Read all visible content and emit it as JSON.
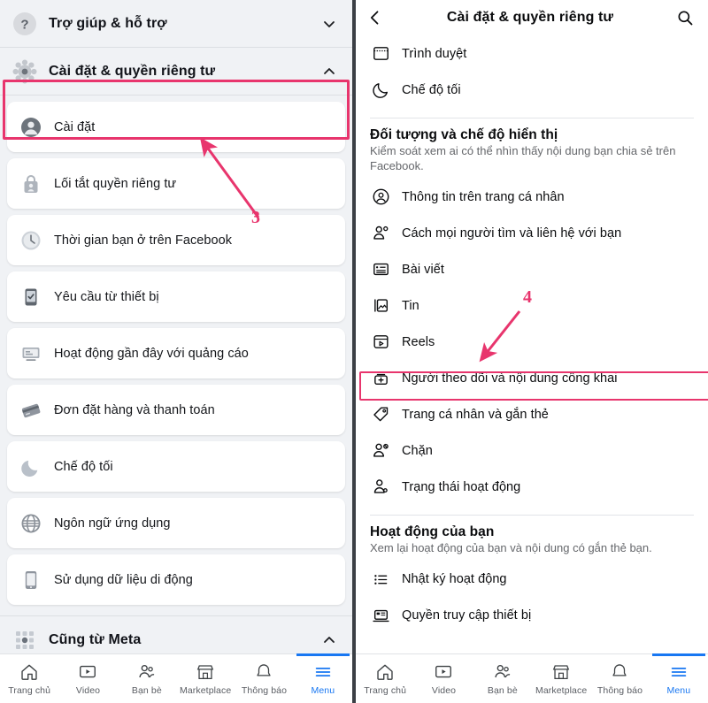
{
  "left_panel": {
    "sections": [
      {
        "id": "help",
        "label": "Trợ giúp & hỗ trợ",
        "icon": "question-circle-icon",
        "chevron": "chevron-down-icon",
        "expanded": false
      },
      {
        "id": "settings_privacy",
        "label": "Cài đặt & quyền riêng tư",
        "icon": "gear-icon",
        "chevron": "chevron-up-icon",
        "expanded": true
      },
      {
        "id": "also_from_meta",
        "label": "Cũng từ Meta",
        "icon": "meta-grid-icon",
        "chevron": "chevron-up-icon",
        "expanded": true
      }
    ],
    "items": [
      {
        "label": "Cài đặt",
        "icon": "person-circle-icon",
        "highlighted": true
      },
      {
        "label": "Lối tắt quyền riêng tư",
        "icon": "privacy-lock-icon",
        "highlighted": false
      },
      {
        "label": "Thời gian bạn ở trên Facebook",
        "icon": "clock-icon",
        "highlighted": false
      },
      {
        "label": "Yêu cầu từ thiết bị",
        "icon": "device-request-icon",
        "highlighted": false
      },
      {
        "label": "Hoạt động gần đây với quảng cáo",
        "icon": "ad-activity-icon",
        "highlighted": false
      },
      {
        "label": "Đơn đặt hàng và thanh toán",
        "icon": "credit-card-icon",
        "highlighted": false
      },
      {
        "label": "Chế độ tối",
        "icon": "moon-icon",
        "highlighted": false
      },
      {
        "label": "Ngôn ngữ ứng dụng",
        "icon": "globe-icon",
        "highlighted": false
      },
      {
        "label": "Sử dụng dữ liệu di động",
        "icon": "mobile-data-icon",
        "highlighted": false
      }
    ]
  },
  "right_panel": {
    "header": {
      "title": "Cài đặt & quyền riêng tư",
      "back_icon": "back-chevron-icon",
      "search_icon": "search-icon"
    },
    "top_items": [
      {
        "label": "Trình duyệt",
        "icon": "browser-icon"
      },
      {
        "label": "Chế độ tối",
        "icon": "moon-icon"
      }
    ],
    "group_audience": {
      "title": "Đối tượng và chế độ hiển thị",
      "subtitle": "Kiểm soát xem ai có thể nhìn thấy nội dung bạn chia sẻ trên Facebook.",
      "items": [
        {
          "label": "Thông tin trên trang cá nhân",
          "icon": "person-circle-outline-icon",
          "highlighted": false
        },
        {
          "label": "Cách mọi người tìm và liên hệ với bạn",
          "icon": "person-search-icon",
          "highlighted": false
        },
        {
          "label": "Bài viết",
          "icon": "post-icon",
          "highlighted": false
        },
        {
          "label": "Tin",
          "icon": "story-icon",
          "highlighted": false
        },
        {
          "label": "Reels",
          "icon": "reels-icon",
          "highlighted": false
        },
        {
          "label": "Người theo dõi và nội dung công khai",
          "icon": "followers-add-icon",
          "highlighted": true
        },
        {
          "label": "Trang cá nhân và gắn thẻ",
          "icon": "tag-icon",
          "highlighted": false
        },
        {
          "label": "Chặn",
          "icon": "person-block-icon",
          "highlighted": false
        },
        {
          "label": "Trạng thái hoạt động",
          "icon": "person-status-icon",
          "highlighted": false
        }
      ]
    },
    "group_activity": {
      "title": "Hoạt động của bạn",
      "subtitle": "Xem lại hoạt động của bạn và nội dung có gắn thẻ bạn.",
      "items": [
        {
          "label": "Nhật ký hoạt động",
          "icon": "activity-log-icon"
        },
        {
          "label": "Quyền truy cập thiết bị",
          "icon": "device-access-icon"
        }
      ]
    }
  },
  "bottom_nav": {
    "items": [
      {
        "label": "Trang chủ",
        "icon": "home-icon",
        "active": false
      },
      {
        "label": "Video",
        "icon": "video-icon",
        "active": false
      },
      {
        "label": "Bạn bè",
        "icon": "friends-icon",
        "active": false
      },
      {
        "label": "Marketplace",
        "icon": "marketplace-icon",
        "active": false
      },
      {
        "label": "Thông báo",
        "icon": "bell-icon",
        "active": false
      },
      {
        "label": "Menu",
        "icon": "hamburger-icon",
        "active": true
      }
    ]
  },
  "annotations": [
    {
      "number": "3",
      "target": "Cài đặt",
      "color": "#e8356d"
    },
    {
      "number": "4",
      "target": "Người theo dõi và nội dung công khai",
      "color": "#e8356d"
    }
  ],
  "colors": {
    "highlight": "#e8356d",
    "accent_blue": "#1877f2",
    "panel_bg": "#f0f2f5",
    "card_bg": "#ffffff",
    "text_primary": "#0b0c0e",
    "text_secondary": "#65676b"
  }
}
